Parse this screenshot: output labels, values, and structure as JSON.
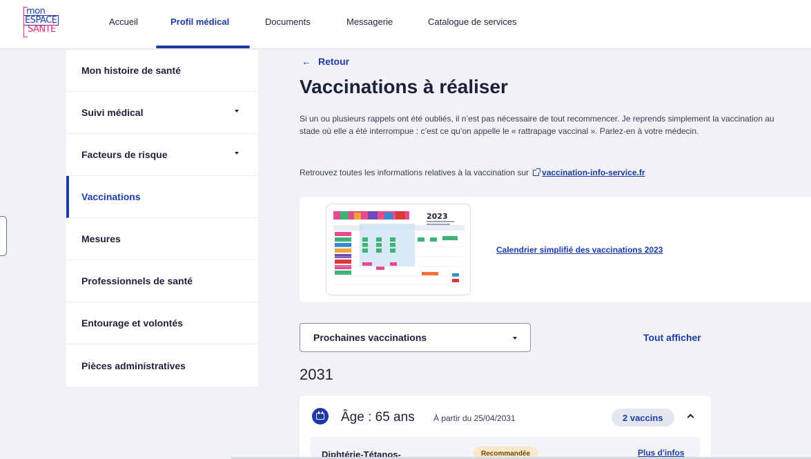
{
  "logo": {
    "line1": "mon",
    "line2": "ESPACE",
    "line3": "SANTÉ"
  },
  "nav": {
    "items": [
      {
        "label": "Accueil"
      },
      {
        "label": "Profil médical"
      },
      {
        "label": "Documents"
      },
      {
        "label": "Messagerie"
      },
      {
        "label": "Catalogue de services"
      }
    ],
    "active_index": 1
  },
  "sidebar": {
    "items": [
      {
        "label": "Mon histoire de santé"
      },
      {
        "label": "Suivi médical"
      },
      {
        "label": "Facteurs de risque"
      },
      {
        "label": "Vaccinations"
      },
      {
        "label": "Mesures"
      },
      {
        "label": "Professionnels de santé"
      },
      {
        "label": "Entourage et volontés"
      },
      {
        "label": "Pièces administratives"
      }
    ],
    "active_index": 3
  },
  "main": {
    "back_label": "Retour",
    "title": "Vaccinations à réaliser",
    "intro": "Si un ou plusieurs rappels ont été oubliés, il n’est pas nécessaire de tout recommencer. Je reprends simplement la vaccination au stade où elle a été interrompue : c’est ce qu’on appelle le « rattrapage vaccinal ». Parlez-en à votre médecin.",
    "info_prefix": "Retrouvez toutes les informations relatives à la vaccination sur",
    "info_link": "vaccination-info-service.fr",
    "calendar": {
      "thumb_year": "2023",
      "link_label": "Calendrier simplifié des vaccinations 2023"
    },
    "filter_select": {
      "value": "Prochaines vaccinations"
    },
    "show_all_label": "Tout afficher",
    "year": "2031",
    "age_group": {
      "age_label": "Âge : 65 ans",
      "date_label": "À partir du 25/04/2031",
      "count_badge": "2 vaccins",
      "vaccine": {
        "name": "Diphtérie-Tétanos-",
        "status": "Recommandée",
        "more_label": "Plus d'infos"
      }
    }
  },
  "colors": {
    "brand_blue": "#1c3aa5",
    "brand_pink": "#e0267d",
    "badge_recommended_bg": "#fbe7c9",
    "badge_count_bg": "#e4e7f2"
  },
  "icons": [
    "arrow-left-icon",
    "external-link-icon",
    "calendar-icon",
    "chevron-up-icon",
    "chevron-down-icon"
  ]
}
